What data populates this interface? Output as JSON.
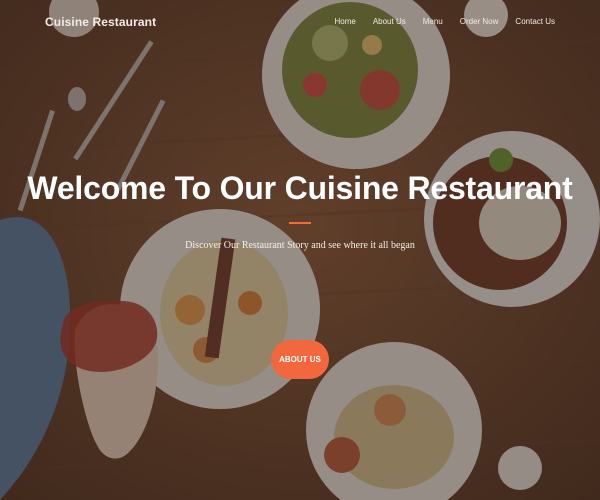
{
  "site": {
    "brand": "Cuisine Restaurant"
  },
  "nav": {
    "items": [
      {
        "label": "Home"
      },
      {
        "label": "About Us"
      },
      {
        "label": "Menu"
      },
      {
        "label": "Order Now"
      },
      {
        "label": "Contact Us"
      }
    ]
  },
  "hero": {
    "title": "Welcome To Our Cuisine Restaurant",
    "subtitle": "Discover Our Restaurant Story and see where it all began",
    "cta_label": "ABOUT US"
  },
  "colors": {
    "accent": "#f2673b",
    "overlay": "#2e1e18"
  }
}
